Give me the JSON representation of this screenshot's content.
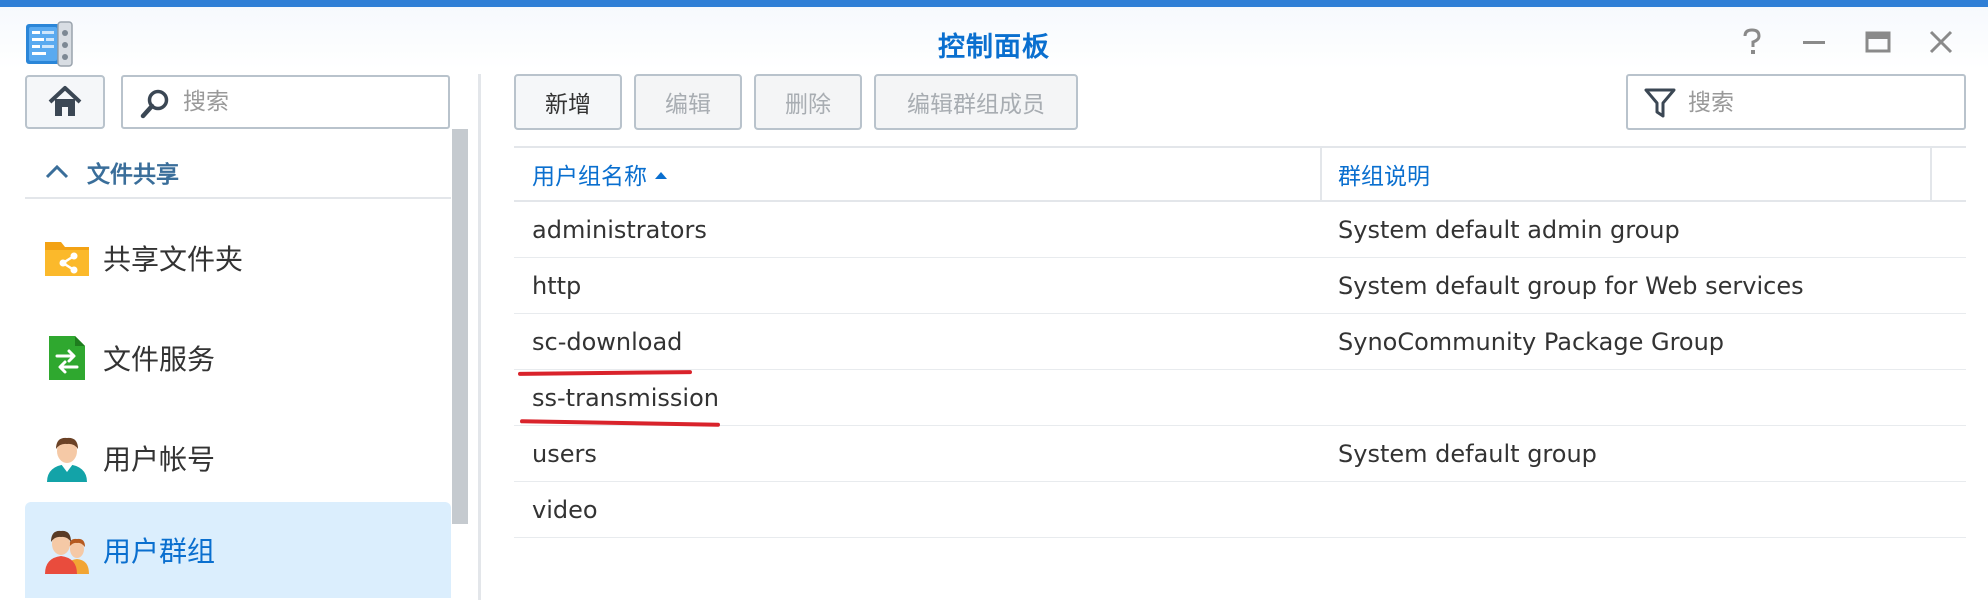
{
  "window": {
    "title": "控制面板",
    "accent_color": "#0a6fcf",
    "controls": [
      "help-icon",
      "minimize-icon",
      "maximize-icon",
      "close-icon"
    ]
  },
  "sidebar": {
    "search_placeholder": "搜索",
    "section_label": "文件共享",
    "items": [
      {
        "label": "共享文件夹",
        "icon": "shared-folder-icon"
      },
      {
        "label": "文件服务",
        "icon": "file-services-icon"
      },
      {
        "label": "用户帐号",
        "icon": "user-icon"
      },
      {
        "label": "用户群组",
        "icon": "group-icon",
        "active": true
      }
    ]
  },
  "toolbar": {
    "create_label": "新增",
    "edit_label": "编辑",
    "delete_label": "删除",
    "edit_members_label": "编辑群组成员",
    "filter_placeholder": "搜索"
  },
  "table": {
    "columns": [
      "用户组名称",
      "群组说明"
    ],
    "sorted_column": "用户组名称",
    "sort_direction": "ascending",
    "rows": [
      {
        "name": "administrators",
        "description": "System default admin group"
      },
      {
        "name": "http",
        "description": "System default group for Web services"
      },
      {
        "name": "sc-download",
        "description": "SynoCommunity Package Group"
      },
      {
        "name": "ss-transmission",
        "description": ""
      },
      {
        "name": "users",
        "description": "System default group"
      },
      {
        "name": "video",
        "description": ""
      }
    ]
  }
}
